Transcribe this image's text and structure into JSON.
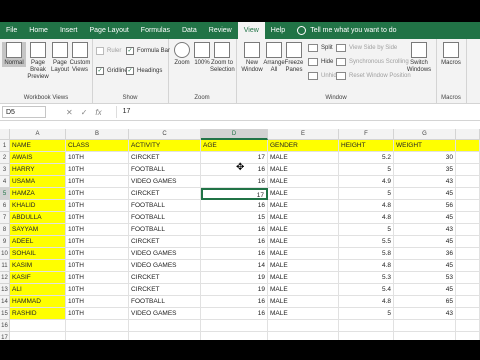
{
  "ribbon_tabs": [
    "File",
    "Home",
    "Insert",
    "Page Layout",
    "Formulas",
    "Data",
    "Review",
    "View",
    "Help"
  ],
  "active_tab": "View",
  "tell_me": "Tell me what you want to do",
  "workbook_views": {
    "normal": "Normal",
    "page_break": "Page Break Preview",
    "page_layout": "Page Layout",
    "custom": "Custom Views",
    "label": "Workbook Views"
  },
  "show": {
    "ruler": "Ruler",
    "formula_bar": "Formula Bar",
    "gridlines": "Gridlines",
    "headings": "Headings",
    "label": "Show"
  },
  "zoom": {
    "zoom": "Zoom",
    "zoom100": "100%",
    "zoom_sel": "Zoom to Selection",
    "label": "Zoom"
  },
  "window": {
    "new_window": "New Window",
    "arrange_all": "Arrange All",
    "freeze": "Freeze Panes",
    "split": "Split",
    "hide": "Hide",
    "unhide": "Unhide",
    "side_by_side": "View Side by Side",
    "sync_scroll": "Synchronous Scrolling",
    "reset_pos": "Reset Window Position",
    "switch": "Switch Windows",
    "label": "Window"
  },
  "macros": {
    "macros": "Macros",
    "label": "Macros"
  },
  "formula_bar": {
    "name_box": "D5",
    "cancel": "✕",
    "enter": "✓",
    "fx": "fx",
    "value": "17"
  },
  "columns": [
    "A",
    "B",
    "C",
    "D",
    "E",
    "F",
    "G"
  ],
  "active_cell": "D5",
  "header_row": [
    "NAME",
    "CLASS",
    "ACTIVITY",
    "AGE",
    "GENDER",
    "HEIGHT",
    "WEIGHT"
  ],
  "rows": [
    [
      "AWAIS",
      "10TH",
      "CIRCKET",
      "17",
      "MALE",
      "5.2",
      "30"
    ],
    [
      "HARRY",
      "10TH",
      "FOOTBALL",
      "16",
      "MALE",
      "5",
      "35"
    ],
    [
      "USAMA",
      "10TH",
      "VIDEO GAMES",
      "16",
      "MALE",
      "4.9",
      "43"
    ],
    [
      "HAMZA",
      "10TH",
      "CIRCKET",
      "17",
      "MALE",
      "5",
      "45"
    ],
    [
      "KHALID",
      "10TH",
      "FOOTBALL",
      "16",
      "MALE",
      "4.8",
      "56"
    ],
    [
      "ABDULLA",
      "10TH",
      "FOOTBALL",
      "15",
      "MALE",
      "4.8",
      "45"
    ],
    [
      "SAYYAM",
      "10TH",
      "FOOTBALL",
      "16",
      "MALE",
      "5",
      "43"
    ],
    [
      "ADEEL",
      "10TH",
      "CIRCKET",
      "16",
      "MALE",
      "5.5",
      "45"
    ],
    [
      "SOHAIL",
      "10TH",
      "VIDEO GAMES",
      "16",
      "MALE",
      "5.8",
      "36"
    ],
    [
      "KASIM",
      "10TH",
      "VIDEO GAMES",
      "14",
      "MALE",
      "4.8",
      "45"
    ],
    [
      "KASIF",
      "10TH",
      "CIRCKET",
      "19",
      "MALE",
      "5.3",
      "53"
    ],
    [
      "ALI",
      "10TH",
      "CIRCKET",
      "19",
      "MALE",
      "5.4",
      "45"
    ],
    [
      "HAMMAD",
      "10TH",
      "FOOTBALL",
      "16",
      "MALE",
      "4.8",
      "65"
    ],
    [
      "RASHID",
      "10TH",
      "VIDEO GAMES",
      "16",
      "MALE",
      "5",
      "43"
    ]
  ],
  "row_numbers": [
    "1",
    "2",
    "3",
    "4",
    "5",
    "6",
    "7",
    "8",
    "9",
    "10",
    "11",
    "12",
    "13",
    "14",
    "15",
    "16",
    "17",
    "18"
  ]
}
